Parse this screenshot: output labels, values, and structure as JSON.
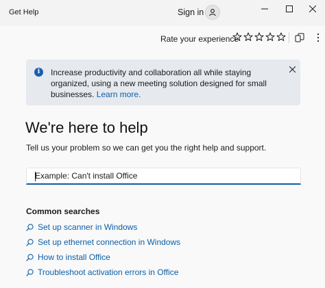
{
  "app": {
    "title": "Get Help"
  },
  "header": {
    "signin_label": "Sign in"
  },
  "toolbar": {
    "rate_label": "Rate your experience",
    "rating": 0,
    "max_rating": 5
  },
  "banner": {
    "text": "Increase productivity and collaboration all while staying organized, using a new meeting solution designed for small businesses. ",
    "link_text": "Learn more."
  },
  "main": {
    "heading": "We're here to help",
    "subtext": "Tell us your problem so we can get you the right help and support.",
    "search_placeholder": "Example: Can't install Office"
  },
  "common": {
    "title": "Common searches",
    "items": [
      {
        "label": "Set up scanner in Windows"
      },
      {
        "label": "Set up ethernet connection in Windows"
      },
      {
        "label": "How to install Office"
      },
      {
        "label": "Troubleshoot activation errors in Office"
      }
    ]
  },
  "colors": {
    "accent": "#0a5fa8",
    "banner_bg": "#e6e9ee",
    "info_icon": "#1a5fb4"
  }
}
